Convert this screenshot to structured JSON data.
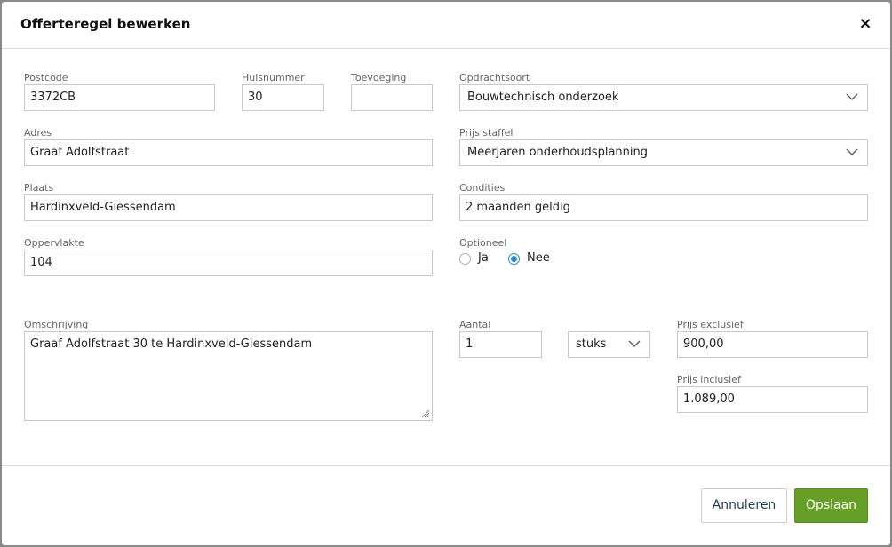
{
  "dialog": {
    "title": "Offerteregel bewerken",
    "close_label": "×"
  },
  "fields": {
    "postcode": {
      "label": "Postcode",
      "value": "3372CB"
    },
    "huisnummer": {
      "label": "Huisnummer",
      "value": "30"
    },
    "toevoeging": {
      "label": "Toevoeging",
      "value": ""
    },
    "adres": {
      "label": "Adres",
      "value": "Graaf Adolfstraat"
    },
    "plaats": {
      "label": "Plaats",
      "value": "Hardinxveld-Giessendam"
    },
    "oppervlakte": {
      "label": "Oppervlakte",
      "value": "104"
    },
    "opdrachtsoort": {
      "label": "Opdrachtsoort",
      "value": "Bouwtechnisch onderzoek"
    },
    "prijs_staffel": {
      "label": "Prijs staffel",
      "value": "Meerjaren onderhoudsplanning"
    },
    "condities": {
      "label": "Condities",
      "value": "2 maanden geldig"
    },
    "optioneel": {
      "label": "Optioneel",
      "options": [
        {
          "label": "Ja",
          "selected": false
        },
        {
          "label": "Nee",
          "selected": true
        }
      ]
    },
    "omschrijving": {
      "label": "Omschrijving",
      "value": "Graaf Adolfstraat 30 te Hardinxveld-Giessendam"
    },
    "aantal": {
      "label": "Aantal",
      "value": "1"
    },
    "eenheid": {
      "value": "stuks"
    },
    "prijs_exclusief": {
      "label": "Prijs exclusief",
      "value": "900,00"
    },
    "prijs_inclusief": {
      "label": "Prijs inclusief",
      "value": "1.089,00"
    }
  },
  "footer": {
    "cancel_label": "Annuleren",
    "save_label": "Opslaan"
  },
  "colors": {
    "accent": "#2b8ccc",
    "save_button": "#669f26",
    "cancel_text": "#1f3b57"
  },
  "icons": {
    "close": "close-icon",
    "dropdown": "chevron-down-icon",
    "resize": "resize-grip-icon"
  }
}
